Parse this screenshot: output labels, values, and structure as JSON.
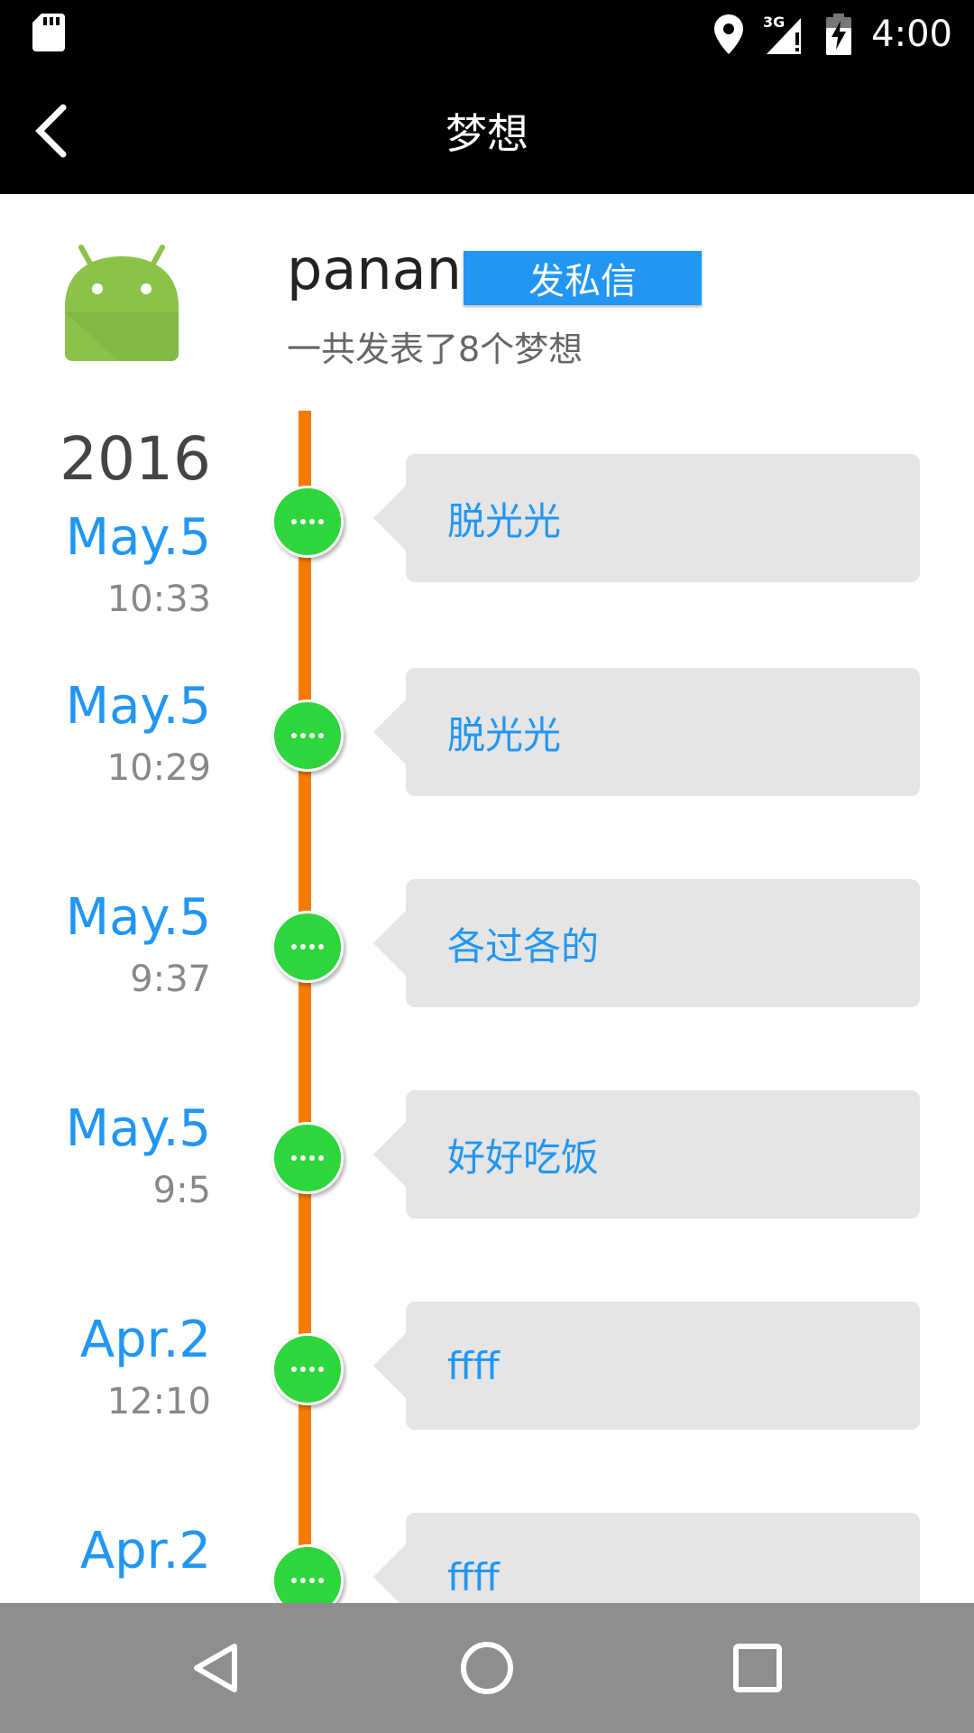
{
  "status_bar": {
    "time": "4:00",
    "network": "3G",
    "icons": [
      "sd-card-icon",
      "location-icon",
      "signal-3g-icon",
      "battery-charging-icon"
    ]
  },
  "app_bar": {
    "title": "梦想",
    "back_icon": "chevron-left-icon"
  },
  "profile": {
    "username": "panan",
    "message_button": "发私信",
    "post_count_text": "一共发表了8个梦想",
    "avatar_icon": "android-icon"
  },
  "timeline": {
    "year": "2016",
    "line_color": "#f57c00",
    "dot_color": "#2fd53c",
    "entries": [
      {
        "date": "May.5",
        "time": "10:33",
        "text": "脱光光"
      },
      {
        "date": "May.5",
        "time": "10:29",
        "text": "脱光光"
      },
      {
        "date": "May.5",
        "time": "9:37",
        "text": "各过各的"
      },
      {
        "date": "May.5",
        "time": "9:5",
        "text": "好好吃饭"
      },
      {
        "date": "Apr.2",
        "time": "12:10",
        "text": "ffff"
      },
      {
        "date": "Apr.2",
        "time": "",
        "text": "ffff"
      }
    ]
  },
  "nav_bar": {
    "back": "triangle-back-icon",
    "home": "circle-home-icon",
    "recents": "square-recents-icon"
  },
  "colors": {
    "accent": "#2196f3",
    "toolbar": "#000000",
    "nav": "#8e8e8e"
  }
}
